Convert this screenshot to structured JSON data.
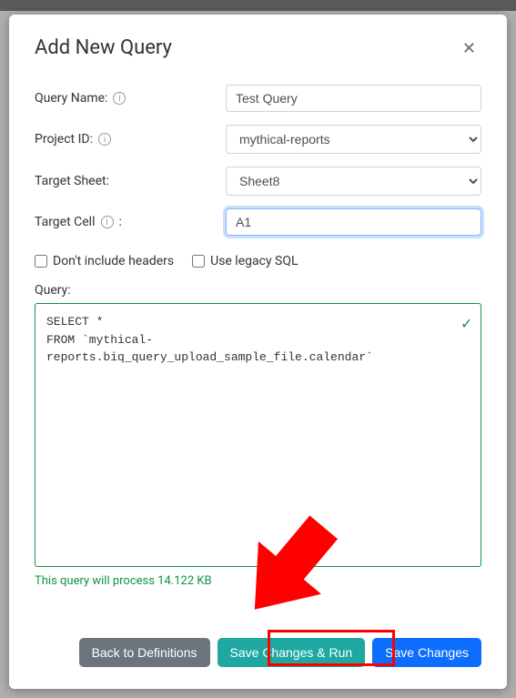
{
  "modal": {
    "title": "Add New Query",
    "labels": {
      "queryName": "Query Name:",
      "projectId": "Project ID:",
      "targetSheet": "Target Sheet:",
      "targetCell": "Target Cell",
      "query": "Query:"
    },
    "fields": {
      "queryName": "Test Query",
      "projectId": "mythical-reports",
      "targetSheet": "Sheet8",
      "targetCell": "A1"
    },
    "checkboxes": {
      "noHeaders": "Don't include headers",
      "legacySql": "Use legacy SQL"
    },
    "queryLines": [
      "SELECT *",
      "FROM `mythical-reports.biq_query_upload_sample_file.calendar`"
    ],
    "processNote": "This query will process 14.122 KB"
  },
  "buttons": {
    "back": "Back to Definitions",
    "saveRun": "Save Changes & Run",
    "save": "Save Changes"
  }
}
